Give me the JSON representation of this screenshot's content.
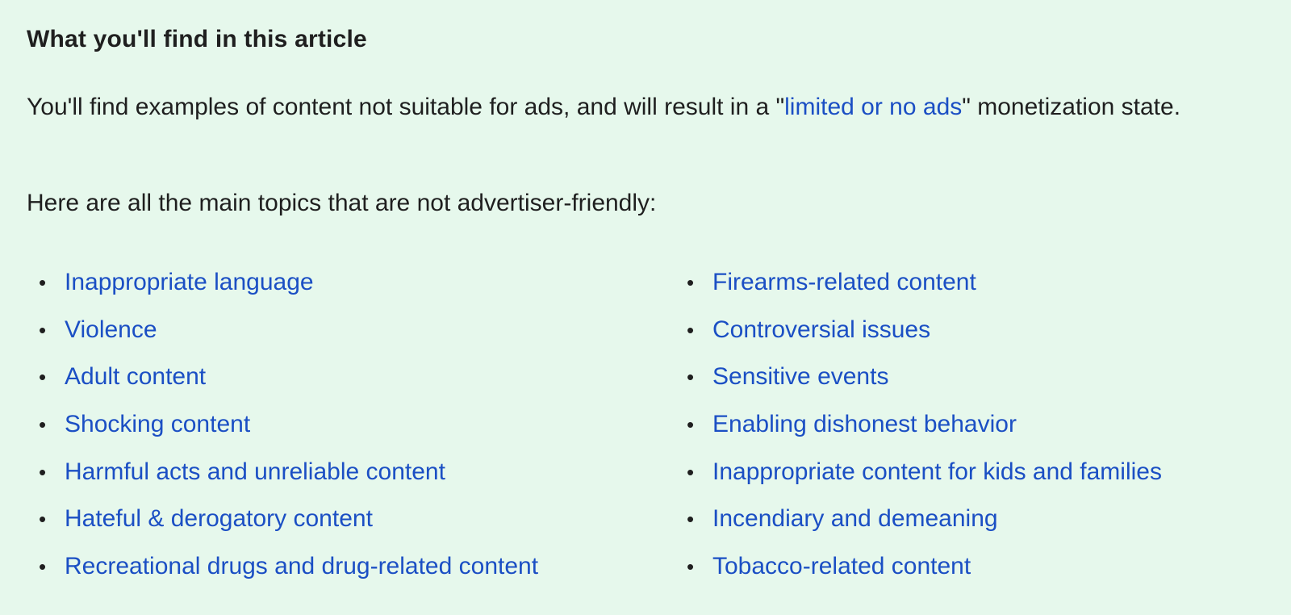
{
  "heading": "What you'll find in this article",
  "intro": {
    "before": "You'll find examples of content not suitable for ads, and will result in a \"",
    "link": "limited or no ads",
    "after": "\" monetization state."
  },
  "lead": "Here are all the main topics that are not advertiser-friendly:",
  "topics_left": [
    "Inappropriate language",
    "Violence",
    "Adult content",
    "Shocking content",
    "Harmful acts and unreliable content",
    "Hateful & derogatory content",
    "Recreational drugs and drug-related content"
  ],
  "topics_right": [
    "Firearms-related content",
    "Controversial issues",
    "Sensitive events",
    "Enabling dishonest behavior",
    "Inappropriate content for kids and families",
    "Incendiary and demeaning",
    "Tobacco-related content"
  ],
  "colors": {
    "background": "#e6f8ec",
    "link": "#1b4fc4",
    "text": "#1f1f1f"
  }
}
